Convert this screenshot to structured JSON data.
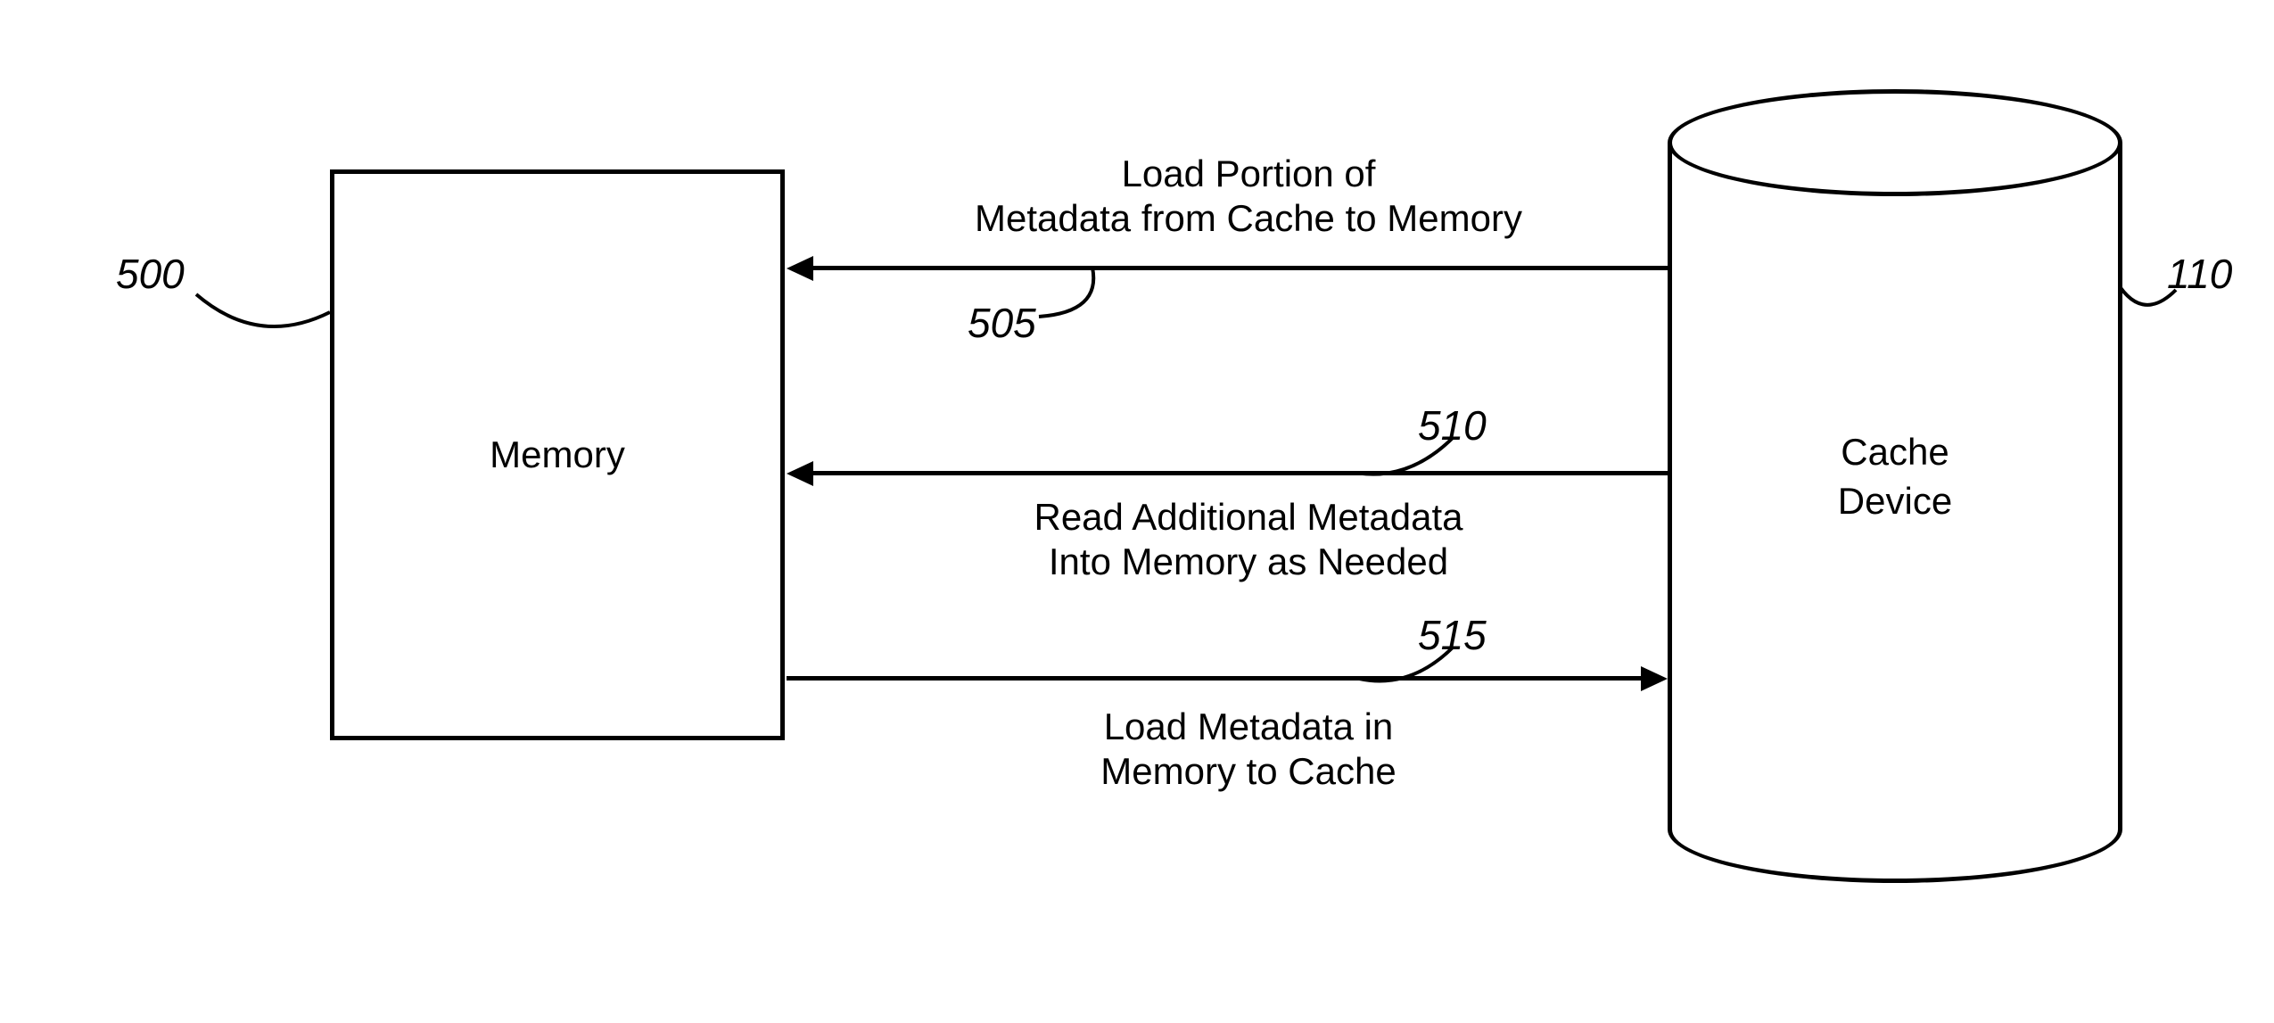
{
  "nodes": {
    "memory": {
      "label": "Memory",
      "ref": "500"
    },
    "cache": {
      "label_line1": "Cache",
      "label_line2": "Device",
      "ref": "110"
    }
  },
  "arrows": {
    "a505": {
      "text_line1": "Load Portion of",
      "text_line2": "Metadata from Cache to Memory",
      "ref": "505"
    },
    "a510": {
      "text_line1": "Read Additional Metadata",
      "text_line2": "Into Memory as Needed",
      "ref": "510"
    },
    "a515": {
      "text_line1": "Load Metadata in",
      "text_line2": "Memory to Cache",
      "ref": "515"
    }
  }
}
